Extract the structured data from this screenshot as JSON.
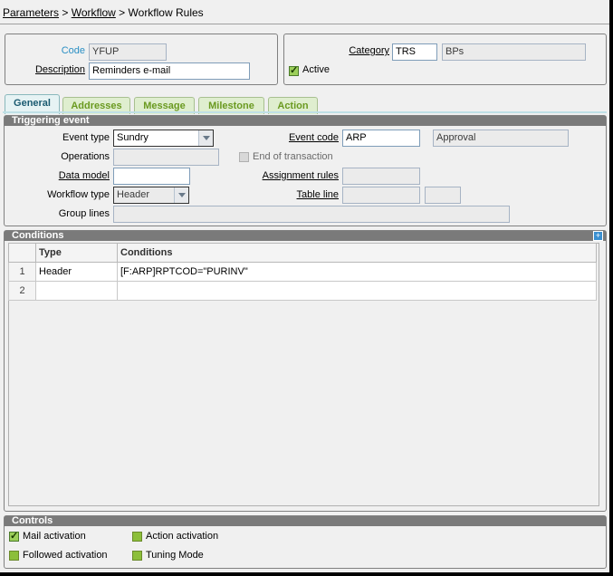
{
  "breadcrumb": {
    "item1": "Parameters",
    "sep1": " > ",
    "item2": "Workflow",
    "sep2": " > ",
    "current": "Workflow Rules"
  },
  "header": {
    "code_label": "Code",
    "code_value": "YFUP",
    "description_label": "Description",
    "description_value": "Reminders e-mail",
    "category_label": "Category",
    "category_code": "TRS",
    "category_name": "BPs",
    "active_label": "Active",
    "active_checked": true
  },
  "tabs": [
    {
      "label": "General",
      "active": true
    },
    {
      "label": "Addresses",
      "active": false
    },
    {
      "label": "Message",
      "active": false
    },
    {
      "label": "Milestone",
      "active": false
    },
    {
      "label": "Action",
      "active": false
    }
  ],
  "triggering": {
    "title": "Triggering event",
    "event_type_label": "Event type",
    "event_type_value": "Sundry",
    "event_code_label": "Event code",
    "event_code_value": "ARP",
    "event_code_desc": "Approval",
    "operations_label": "Operations",
    "operations_value": "",
    "end_of_transaction_label": "End of transaction",
    "data_model_label": "Data model",
    "data_model_value": "",
    "assignment_rules_label": "Assignment rules",
    "assignment_rules_value": "",
    "workflow_type_label": "Workflow type",
    "workflow_type_value": "Header",
    "table_line_label": "Table line",
    "group_lines_label": "Group lines"
  },
  "conditions": {
    "title": "Conditions",
    "columns": [
      "Type",
      "Conditions"
    ],
    "rows": [
      {
        "num": "1",
        "type": "Header",
        "condition": "[F:ARP]RPTCOD=\"PURINV\""
      },
      {
        "num": "2",
        "type": "",
        "condition": ""
      }
    ]
  },
  "controls": {
    "title": "Controls",
    "mail_activation": "Mail activation",
    "followed_activation": "Followed activation",
    "action_activation": "Action activation",
    "tuning_mode": "Tuning Mode"
  },
  "colors": {
    "tab_text": "#6a9a20",
    "active_tab_text": "#1a5a70",
    "section_header": "#7a7a7a",
    "link_label": "#2a8fc4"
  }
}
